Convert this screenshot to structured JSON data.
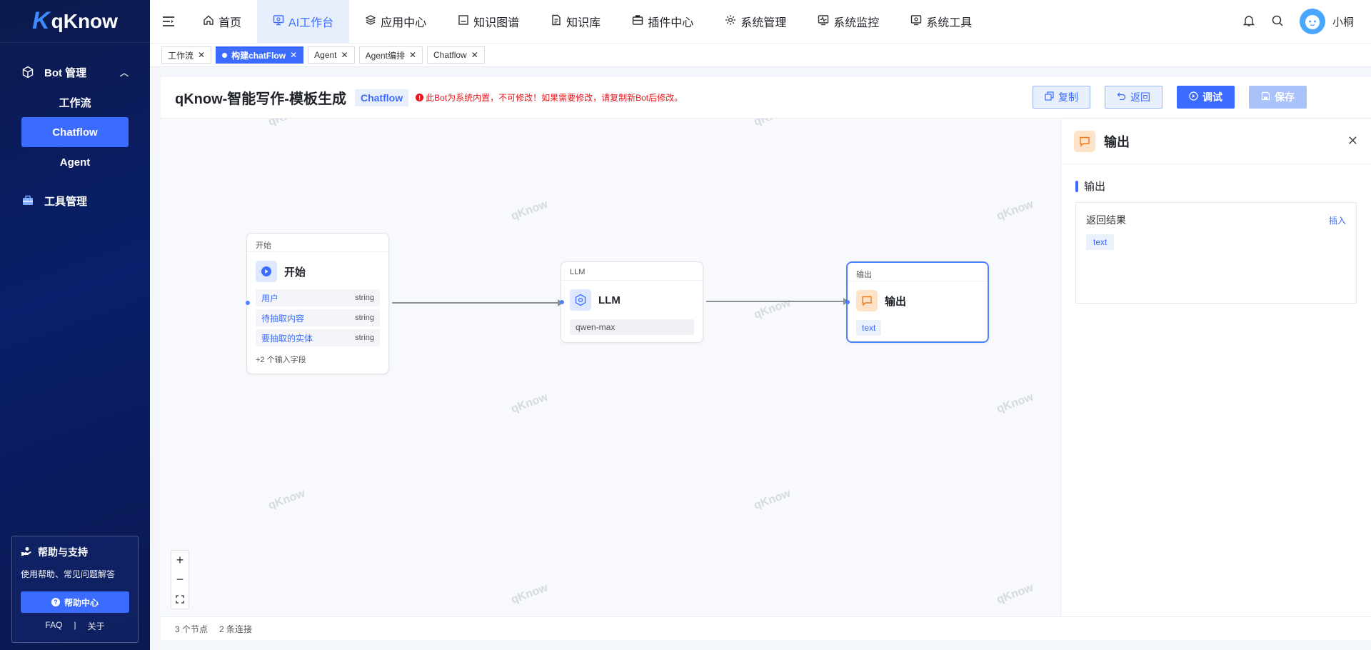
{
  "brand": {
    "logo_mark": "K",
    "name": "qKnow"
  },
  "sidebar": {
    "groups": [
      {
        "label": "Bot 管理",
        "icon": "cube-icon",
        "items": [
          {
            "label": "工作流"
          },
          {
            "label": "Chatflow",
            "active": true
          },
          {
            "label": "Agent"
          }
        ]
      },
      {
        "label": "工具管理",
        "icon": "toolbox-icon"
      }
    ],
    "help": {
      "title": "帮助与支持",
      "desc": "使用帮助、常见问题解答",
      "button": "帮助中心",
      "faq": "FAQ",
      "about": "关于"
    }
  },
  "topnav": {
    "items": [
      {
        "label": "首页",
        "icon": "home-icon"
      },
      {
        "label": "AI工作台",
        "icon": "monitor-icon",
        "active": true
      },
      {
        "label": "应用中心",
        "icon": "layers-icon"
      },
      {
        "label": "知识图谱",
        "icon": "graph-icon"
      },
      {
        "label": "知识库",
        "icon": "book-icon"
      },
      {
        "label": "插件中心",
        "icon": "plugin-icon"
      },
      {
        "label": "系统管理",
        "icon": "gear-icon"
      },
      {
        "label": "系统监控",
        "icon": "pulse-icon"
      },
      {
        "label": "系统工具",
        "icon": "tools-icon"
      }
    ],
    "username": "小桐"
  },
  "tabs": [
    {
      "label": "工作流"
    },
    {
      "label": "构建chatFlow",
      "active": true
    },
    {
      "label": "Agent"
    },
    {
      "label": "Agent编排"
    },
    {
      "label": "Chatflow"
    }
  ],
  "header": {
    "title": "qKnow-智能写作-模板生成",
    "type_badge": "Chatflow",
    "warning": "此Bot为系统内置，不可修改！如果需要修改，请复制新Bot后修改。",
    "buttons": {
      "copy": "复制",
      "back": "返回",
      "debug": "调试",
      "save": "保存"
    }
  },
  "watermark": "qKnow",
  "nodes": {
    "start": {
      "caption": "开始",
      "title": "开始",
      "fields": [
        {
          "name": "用户",
          "type": "string"
        },
        {
          "name": "待抽取内容",
          "type": "string"
        },
        {
          "name": "要抽取的实体",
          "type": "string"
        }
      ],
      "more": "+2 个输入字段"
    },
    "llm": {
      "caption": "LLM",
      "title": "LLM",
      "model": "qwen-max"
    },
    "output": {
      "caption": "输出",
      "title": "输出",
      "var": "text"
    }
  },
  "panel": {
    "title": "输出",
    "section": "输出",
    "result_label": "返回结果",
    "insert": "插入",
    "chip": "text"
  },
  "footer": {
    "nodes": "3 个节点",
    "edges": "2 条连接"
  },
  "colors": {
    "accent": "#3b6cff",
    "sidebar": "#0a1f6b",
    "warning": "#e8151b"
  }
}
